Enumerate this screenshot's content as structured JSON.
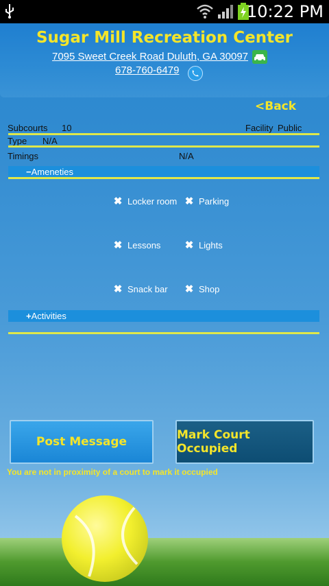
{
  "status_bar": {
    "time": "10:22 PM"
  },
  "header": {
    "title": "Sugar Mill Recreation Center",
    "address": "7095 Sweet Creek Road Duluth, GA 30097",
    "phone": "678-760-6479"
  },
  "back_label": "<Back",
  "details": {
    "subcourts_label": "Subcourts",
    "subcourts_value": "10",
    "facility_label": "Facility",
    "facility_value": "Public",
    "type_label": "Type",
    "type_value": "N/A",
    "timings_label": "Timings",
    "timings_value": "N/A"
  },
  "ameneties": {
    "toggle": "−",
    "label": "Ameneties",
    "items": [
      "Locker room",
      "Parking",
      "Lessons",
      "Lights",
      "Snack bar",
      "Shop"
    ],
    "mark": "✖"
  },
  "activities": {
    "toggle": "+",
    "label": "Activities"
  },
  "buttons": {
    "post_message": "Post Message",
    "mark_occupied": "Mark Court Occupied"
  },
  "warning": "You are not in proximity of a court to mark it occupied"
}
